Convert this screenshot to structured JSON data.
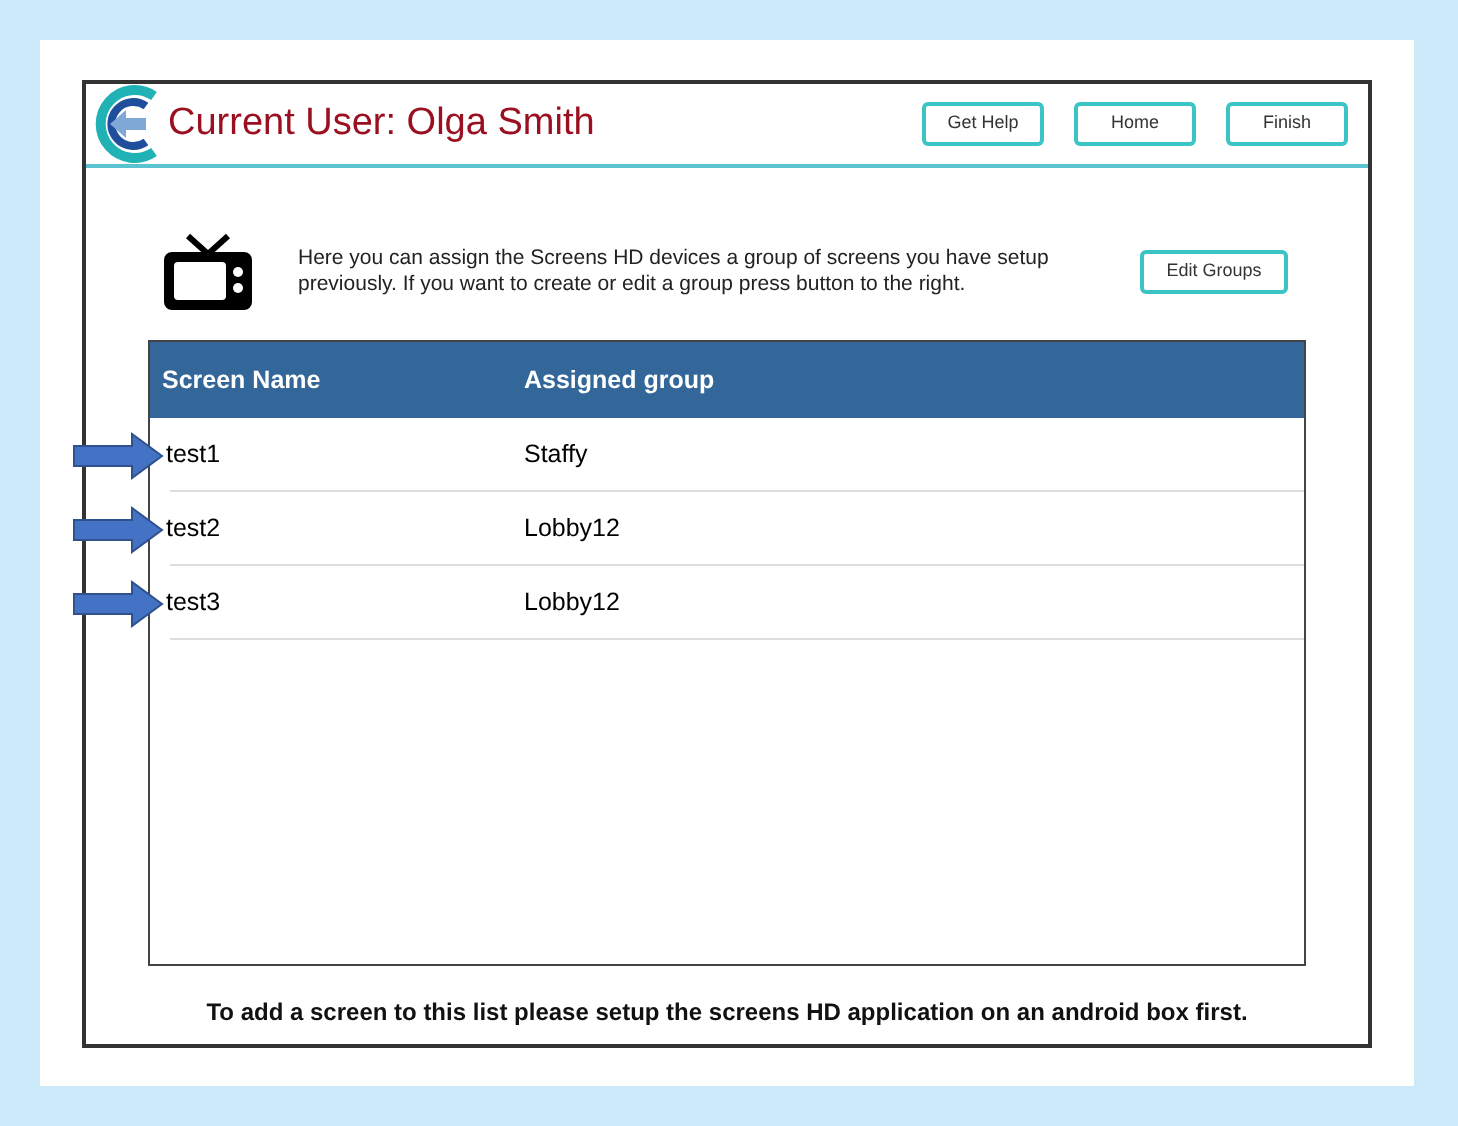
{
  "header": {
    "title": "Current User: Olga Smith",
    "buttons": [
      "Get Help",
      "Home",
      "Finish"
    ]
  },
  "intro": {
    "text": "Here you can assign the Screens HD devices a group of screens you have setup previously. If you want to create or edit a group press button to the right.",
    "button": "Edit Groups"
  },
  "table": {
    "columns": [
      "Screen Name",
      "Assigned group"
    ],
    "rows": [
      {
        "cells": [
          "test1",
          "Staffy"
        ],
        "marked": true
      },
      {
        "cells": [
          "test2",
          "Lobby12"
        ],
        "marked": true
      },
      {
        "cells": [
          "test3",
          "Lobby12"
        ],
        "marked": true
      }
    ]
  },
  "footer": "To add a screen to this list please setup the screens HD application on an android box first."
}
